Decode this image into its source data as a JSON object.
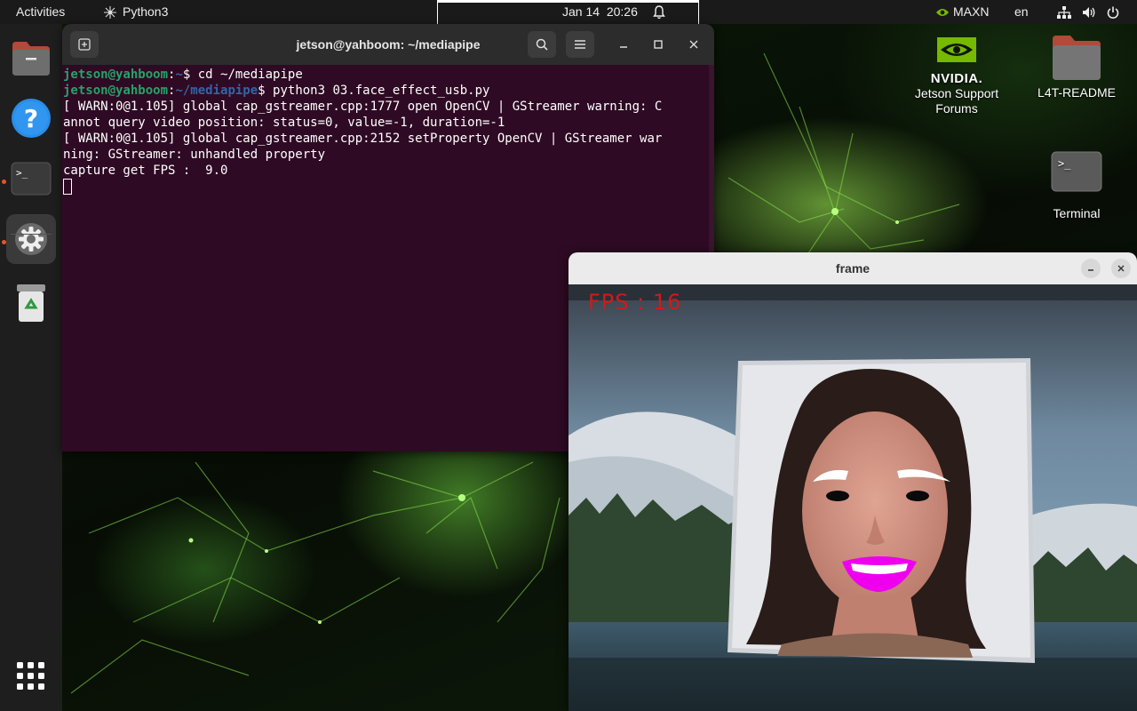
{
  "topbar": {
    "activities": "Activities",
    "app_name": "Python3",
    "date": "Jan 14",
    "time": "20:26",
    "power_mode": "MAXN",
    "language": "en"
  },
  "dock": {
    "items": [
      {
        "name": "Files",
        "icon": "folder-icon"
      },
      {
        "name": "Help",
        "icon": "help-icon"
      },
      {
        "name": "Terminal",
        "icon": "terminal-icon"
      },
      {
        "name": "Settings",
        "icon": "gear-icon"
      },
      {
        "name": "Trash",
        "icon": "trash-icon"
      }
    ],
    "show_apps_icon": "app-grid-icon"
  },
  "terminal": {
    "title": "jetson@yahboom: ~/mediapipe",
    "lines": [
      {
        "user": "jetson@yahboom",
        "path": "~",
        "cmd": "cd ~/mediapipe"
      },
      {
        "user": "jetson@yahboom",
        "path": "~/mediapipe",
        "cmd": "python3 03.face_effect_usb.py"
      },
      {
        "text": "[ WARN:0@1.105] global cap_gstreamer.cpp:1777 open OpenCV | GStreamer warning: C"
      },
      {
        "text": "annot query video position: status=0, value=-1, duration=-1"
      },
      {
        "text": "[ WARN:0@1.105] global cap_gstreamer.cpp:2152 setProperty OpenCV | GStreamer war"
      },
      {
        "text": "ning: GStreamer: unhandled property"
      },
      {
        "text": "capture get FPS :  9.0"
      }
    ]
  },
  "desktop": {
    "icons": [
      {
        "label_line1": "Jetson Support",
        "label_line2": "Forums",
        "logo_text": "NVIDIA."
      },
      {
        "label": "L4T-README"
      },
      {
        "label": "Terminal"
      }
    ]
  },
  "frame": {
    "title": "frame",
    "fps_overlay": "FPS : 16"
  },
  "colors": {
    "terminal_bg": "#2f0a24",
    "prompt_user": "#26a269",
    "prompt_path": "#3465a4",
    "nvidia_green": "#76b900",
    "fps_red": "#d01a1a",
    "lip_effect": "#ee00ee"
  }
}
